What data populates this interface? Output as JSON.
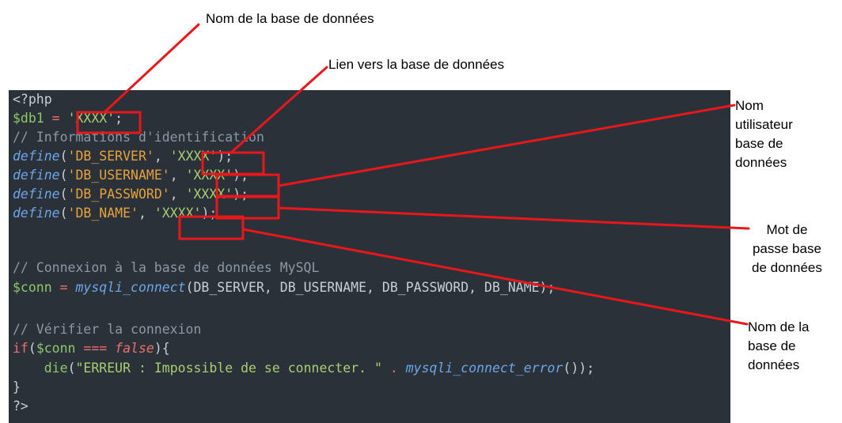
{
  "annotations": {
    "db_name_top": "Nom de la base de données",
    "db_link": "Lien vers la base de données",
    "db_user": [
      "Nom",
      "utilisateur",
      "base de",
      "données"
    ],
    "db_password": [
      "Mot de",
      "passe base",
      "de données"
    ],
    "db_name_right": [
      "Nom de la",
      "base de",
      "données"
    ]
  },
  "code": {
    "line1": "<?php",
    "line2": {
      "var": "$db1",
      "op": " = ",
      "str": "'XXXX'",
      "end": ";"
    },
    "line3": "// Informations d'identification",
    "line4": {
      "fn": "define",
      "open": "(",
      "const": "'DB_SERVER'",
      "sep": ", ",
      "str": "'XXXX'",
      "end": ");"
    },
    "line5": {
      "fn": "define",
      "open": "(",
      "const": "'DB_USERNAME'",
      "sep": ", ",
      "str": "'XXXX'",
      "end": ");"
    },
    "line6": {
      "fn": "define",
      "open": "(",
      "const": "'DB_PASSWORD'",
      "sep": ", ",
      "str": "'XXXX'",
      "end": ");"
    },
    "line7": {
      "fn": "define",
      "open": "(",
      "const": "'DB_NAME'",
      "sep": ", ",
      "str": "'XXXX'",
      "end": ");"
    },
    "line9": "// Connexion à la base de données MySQL",
    "line10": {
      "var": "$conn",
      "op": " = ",
      "fn": "mysqli_connect",
      "args": "(DB_SERVER, DB_USERNAME, DB_PASSWORD, DB_NAME);"
    },
    "line12": "// Vérifier la connexion",
    "line13": {
      "kw": "if",
      "open": "(",
      "var": "$conn",
      "op": " === ",
      "bool": "false",
      "end": "){"
    },
    "line14": {
      "indent": "    ",
      "die": "die",
      "open": "(",
      "str": "\"ERREUR : Impossible de se connecter. \"",
      "dot": " . ",
      "fn": "mysqli_connect_error",
      "end": "());"
    },
    "line15": "}",
    "line16": "?>"
  },
  "colors": {
    "editor_bg": "#2a3139",
    "highlight_box": "#e8171c",
    "leader_line": "#e8171c"
  }
}
